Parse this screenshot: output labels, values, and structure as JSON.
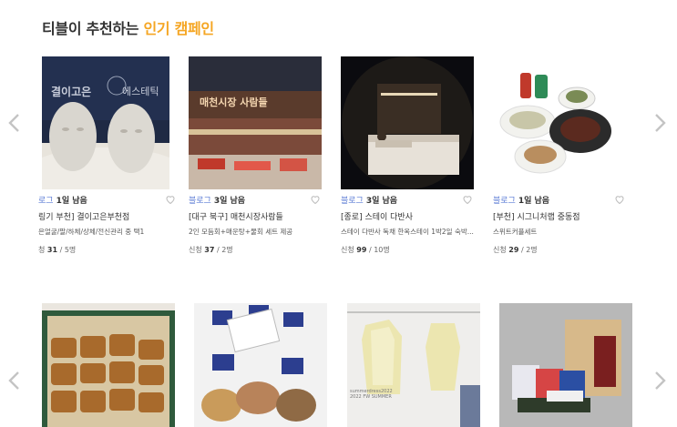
{
  "section": {
    "title_prefix": "티블이 추천하는 ",
    "title_highlight": "인기 캠페인"
  },
  "colors": {
    "accent": "#f5a623",
    "badge": "#5b7bd5"
  },
  "nav": {
    "prev_icon": "chevron-left-icon",
    "next_icon": "chevron-right-icon"
  },
  "row1": [
    {
      "badge": "로그",
      "days": "1일 남음",
      "name": "링기 부천] 결이고은부천점",
      "desc": "은얼굴/팔/하체/상체/전신관리 중 택1",
      "apply_label": "청 ",
      "applied": "31",
      "total": " / 5명"
    },
    {
      "badge": "블로그",
      "days": "3일 남음",
      "name": "[대구 북구] 매천시장사람들",
      "desc": "2인 모듬회+매운탕+물회 세트 제공",
      "apply_label": "신청 ",
      "applied": "37",
      "total": " / 2명"
    },
    {
      "badge": "블로그",
      "days": "3일 남음",
      "name": "[종로] 스테이 다반사",
      "desc": "스테이 다반사 독채 한옥스테이 1박2일 숙박...",
      "apply_label": "신청 ",
      "applied": "99",
      "total": " / 10명"
    },
    {
      "badge": "블로그",
      "days": "1일 남음",
      "name": "[부천] 시그니처랩 중동점",
      "desc": "스위트커플세트",
      "apply_label": "신청 ",
      "applied": "29",
      "total": " / 2명"
    }
  ],
  "row1_images": {
    "img1_text_left": "결이고은",
    "img1_text_right": "에스테틱",
    "img2_sign": "매천시장 사람들"
  },
  "row2_images": {
    "img3_caption_1": "summerdress2022",
    "img3_caption_2": "2022 FW SUMMER"
  }
}
